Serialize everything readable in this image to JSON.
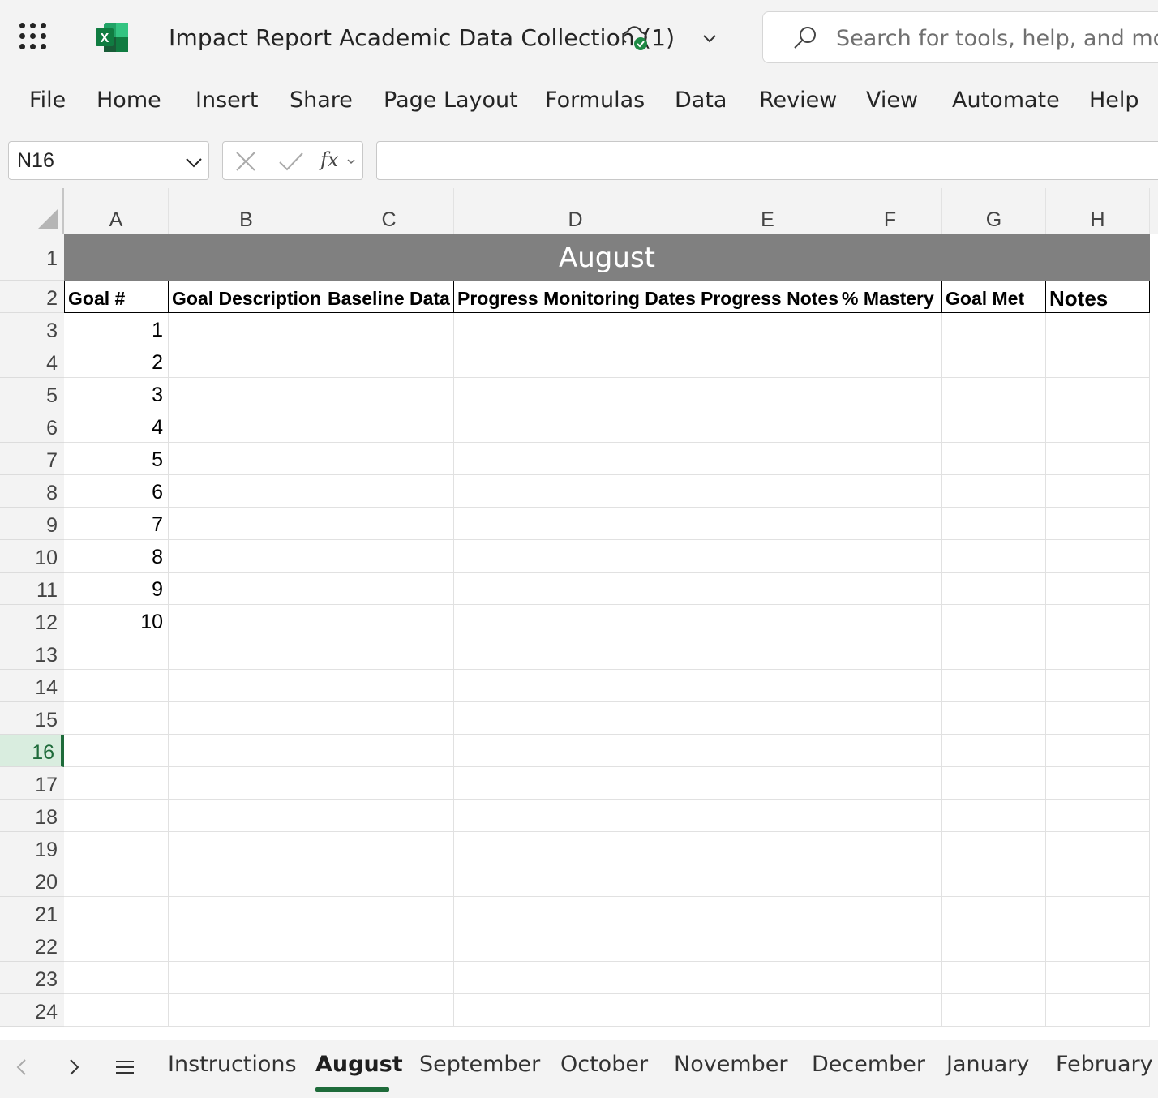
{
  "titlebar": {
    "doc_title": "Impact Report Academic Data Collection (1)",
    "search_placeholder": "Search for tools, help, and more"
  },
  "menu": [
    "File",
    "Home",
    "Insert",
    "Share",
    "Page Layout",
    "Formulas",
    "Data",
    "Review",
    "View",
    "Automate",
    "Help"
  ],
  "formula_bar": {
    "name_box": "N16",
    "fx_label": "fx",
    "formula": ""
  },
  "columns": [
    "A",
    "B",
    "C",
    "D",
    "E",
    "F",
    "G",
    "H"
  ],
  "rows": [
    "1",
    "2",
    "3",
    "4",
    "5",
    "6",
    "7",
    "8",
    "9",
    "10",
    "11",
    "12",
    "13",
    "14",
    "15",
    "16",
    "17",
    "18",
    "19",
    "20",
    "21",
    "22",
    "23",
    "24"
  ],
  "active_row": "16",
  "sheet": {
    "banner": "August",
    "headers": [
      "Goal #",
      "Goal Description",
      "Baseline Data",
      "Progress Monitoring Dates",
      "Progress Notes",
      "% Mastery",
      "Goal Met",
      "Notes"
    ],
    "goal_numbers": [
      "1",
      "2",
      "3",
      "4",
      "5",
      "6",
      "7",
      "8",
      "9",
      "10"
    ]
  },
  "tabs": [
    "Instructions",
    "August",
    "September",
    "October",
    "November",
    "December",
    "January",
    "February"
  ],
  "active_tab": "August",
  "colors": {
    "accent": "#1e6b3a",
    "banner_bg": "#808080",
    "excel_green": "#107c41"
  }
}
